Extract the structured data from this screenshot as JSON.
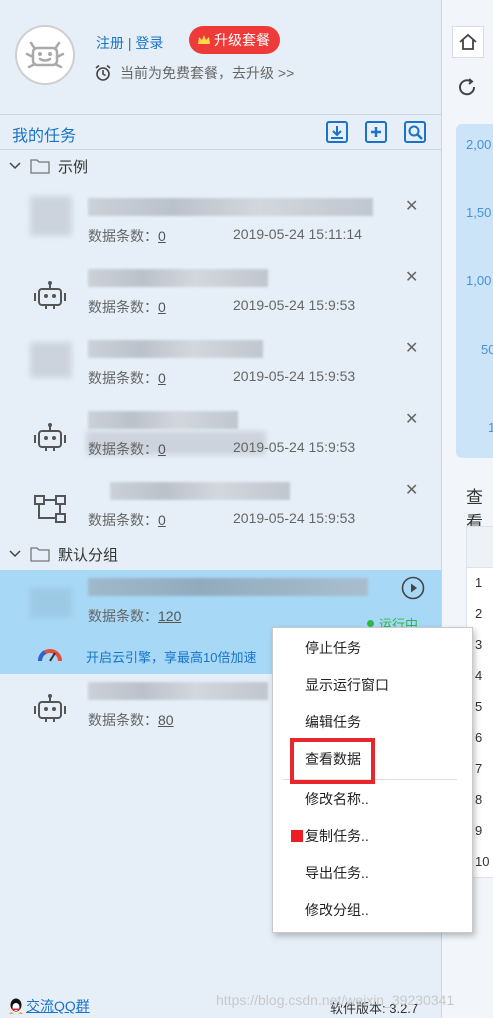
{
  "header": {
    "register": "注册",
    "separator": "|",
    "login": "登录",
    "upgrade_label": "升级套餐",
    "plan_text": "当前为免费套餐，去升级 >>"
  },
  "tasks_panel": {
    "title": "我的任务",
    "groups": [
      {
        "name": "示例",
        "tasks": [
          {
            "count_label": "数据条数：",
            "count": "0",
            "date": "2019-05-24 15:11:14"
          },
          {
            "count_label": "数据条数：",
            "count": "0",
            "date": "2019-05-24 15:9:53"
          },
          {
            "count_label": "数据条数：",
            "count": "0",
            "date": "2019-05-24 15:9:53"
          },
          {
            "count_label": "数据条数：",
            "count": "0",
            "date": "2019-05-24 15:9:53"
          },
          {
            "count_label": "数据条数：",
            "count": "0",
            "date": "2019-05-24 15:9:53"
          }
        ]
      },
      {
        "name": "默认分组",
        "tasks": [
          {
            "count_label": "数据条数：",
            "count": "120",
            "status": "运行中"
          },
          {
            "count_label": "数据条数：",
            "count": "80"
          }
        ]
      }
    ],
    "promo_text": "开启云引擎，享最高10倍加速"
  },
  "context_menu": {
    "items": [
      "停止任务",
      "显示运行窗口",
      "编辑任务",
      "查看数据",
      "修改名称..",
      "复制任务..",
      "导出任务..",
      "修改分组.."
    ]
  },
  "footer": {
    "qq_group": "交流QQ群",
    "version": "软件版本: 3.2.7",
    "watermark": "https://blog.csdn.net/weixin_39230341"
  },
  "right_panel": {
    "y_ticks": [
      "2,00",
      "1,50",
      "1,00",
      "50",
      "1"
    ],
    "view_tab": "查看",
    "row_numbers": [
      "1",
      "2",
      "3",
      "4",
      "5",
      "6",
      "7",
      "8",
      "9",
      "10"
    ]
  },
  "colors": {
    "accent": "#1a73c8",
    "upgrade": "#ef3a3a",
    "active_row": "#a7d8f6",
    "running": "#2db84c",
    "highlight": "#e8262b"
  }
}
